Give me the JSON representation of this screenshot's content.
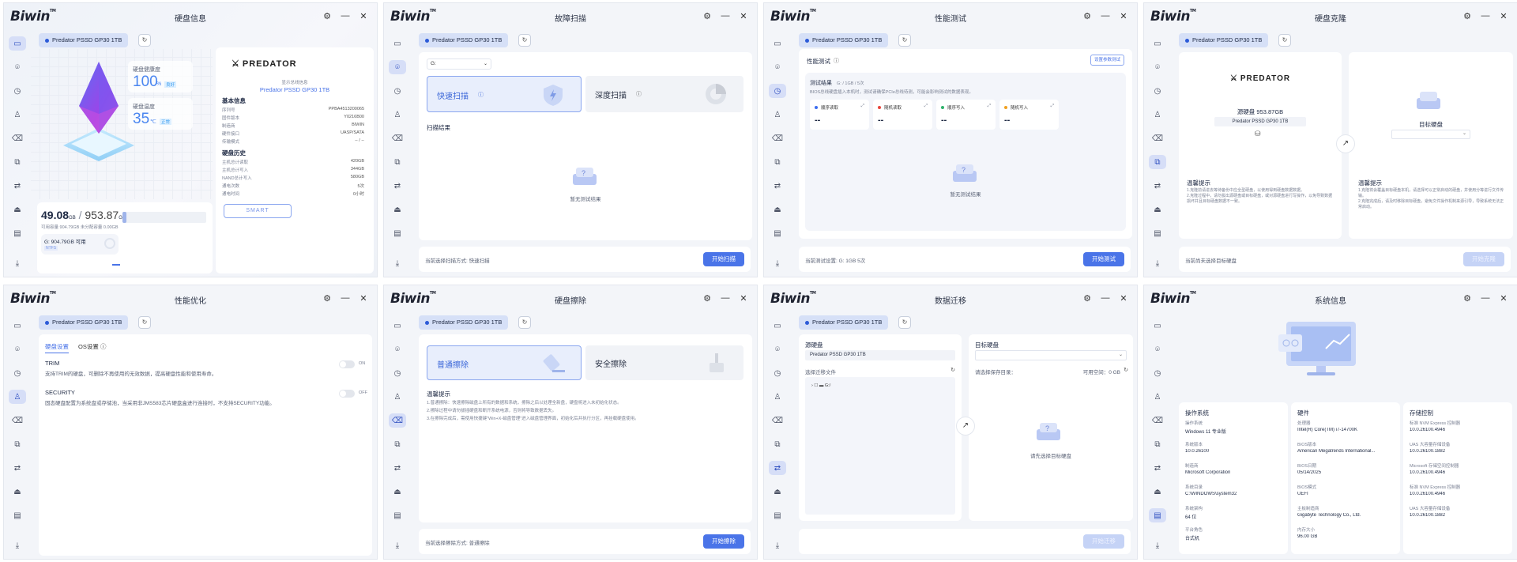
{
  "brand": {
    "logo_text": "Biwin"
  },
  "drive_name": "Predator PSSD GP30 1TB",
  "win1": {
    "title": "硬盘信息",
    "health_label": "硬盘健康度",
    "health_value": "100",
    "health_unit": "%",
    "health_badge": "良好",
    "temp_label": "硬盘温度",
    "temp_value": "35",
    "temp_unit": "℃",
    "temp_badge": "正常",
    "used": "49.08",
    "used_unit": "GB",
    "total": "953.87",
    "total_unit": "GB",
    "cap_sub": "可用容量 904.79GB  未分配容量 0.00GB",
    "usage_fraction": 0.05,
    "partition": "G: 904.79GB 可用",
    "partition_fs": "NTFS",
    "brand_logo": "PREDATOR",
    "model_small": "显示总线信息",
    "model": "Predator PSSD GP30 1TB",
    "basic_title": "基本信息",
    "basic": [
      {
        "k": "序列号",
        "v": "PPBA4513200065"
      },
      {
        "k": "固件版本",
        "v": "Y0216B00"
      },
      {
        "k": "制造商",
        "v": "BIWIN"
      },
      {
        "k": "硬件接口",
        "v": "UASP/SATA"
      },
      {
        "k": "传输模式",
        "v": "-- / --"
      }
    ],
    "history_title": "硬盘历史",
    "history": [
      {
        "k": "主机总计读取",
        "v": "420GB"
      },
      {
        "k": "主机总计写入",
        "v": "344GB"
      },
      {
        "k": "NAND总计写入",
        "v": "580GB"
      },
      {
        "k": "通电次数",
        "v": "5次"
      },
      {
        "k": "通电时间",
        "v": "0小时"
      }
    ],
    "smart_btn": "SMART"
  },
  "win2": {
    "title": "故障扫描",
    "drive_select": "G:",
    "quick_scan": "快速扫描",
    "deep_scan": "深度扫描",
    "result_title": "扫描结果",
    "empty_text": "暂无测试结果",
    "footer_text": "当前选择扫描方式: 快速扫描",
    "start_btn": "开始扫描"
  },
  "win3": {
    "title": "性能测试",
    "section": "性能测试",
    "settings_btn": "设置参数测试",
    "result_title": "测试结果",
    "result_meta": "G: / 1GB / 5次",
    "result_desc": "BIOS总线硬盘插入本机时，测试请确保PCIe总线待测，可能会影响测试的数据表现。",
    "cards": [
      {
        "label": "顺序读取",
        "value": "--",
        "color": "#3c6df0"
      },
      {
        "label": "随机读取",
        "value": "--",
        "color": "#e8453c"
      },
      {
        "label": "顺序写入",
        "value": "--",
        "color": "#2fb36b"
      },
      {
        "label": "随机写入",
        "value": "--",
        "color": "#f0a020"
      }
    ],
    "empty_text": "暂无测试结果",
    "footer_text": "当前测试设置: G:  1GB  5次",
    "start_btn": "开始测试"
  },
  "win4": {
    "title": "硬盘克隆",
    "brand_logo": "PREDATOR",
    "source_label": "源硬盘 953.87GB",
    "source_drive": "Predator PSSD GP30 1TB",
    "target_label": "目标硬盘",
    "tip_title_l": "温馨提示",
    "tip_l": "1.克隆前请进去等待备份中应全型硬盘，以使用得到硬盘数据数据。\n2.克隆过程中，请勿拔出源硬盘或目标硬盘，或对源硬盘进行写操作，以免导致数据损坏并且目标硬盘数据不一致。",
    "tip_title_r": "温馨提示",
    "tip_r": "1.克隆将会覆盖目标硬盘本机，请选择可以正常启动的硬盘，并使用分等进行文件传输。\n2.克隆完成后，请及时移除目标硬盘，避免文件操作机制来源引导，导致系统无法正常启动。",
    "footer_text": "当前尚未选择目标硬盘",
    "start_btn": "开始克隆"
  },
  "win5": {
    "title": "性能优化",
    "tab1": "硬盘设置",
    "tab2": "OS设置",
    "trim_title": "TRIM",
    "trim_desc": "支持TRIM的硬盘，可删除不再使用的无效数据，提高硬盘性能和使用寿命。",
    "trim_state": "ON",
    "security_title": "SECURITY",
    "security_desc": "固态硬盘配置为系统盘或存储池，当采用非JMS583芯片硬盘盒进行连接时，不支持SECURITY功能。",
    "security_state": "OFF"
  },
  "win6": {
    "title": "硬盘擦除",
    "normal_erase": "普通擦除",
    "secure_erase": "安全擦除",
    "tip_title": "温馨提示",
    "tips": [
      "1.普通擦除：快速擦除磁盘上所有的数据和系统，擦除之后以处理全新盘，硬盘将进入未初始化状态。",
      "2.擦除过程中请勿拔插硬盘和断开系统电源，否则将导致数据丢失。",
      "3.在擦除完成后，需使用快捷键\"Win+X-磁盘管理\"进入磁盘管理界面，初始化后并执行分区，再挂载硬盘使用。"
    ],
    "footer_text": "当前选择擦除方式: 普通擦除",
    "start_btn": "开始擦除"
  },
  "win7": {
    "title": "数据迁移",
    "source_label": "源硬盘",
    "source_drive": "Predator PSSD GP30 1TB",
    "select_files": "选择迁移文件",
    "tree_item": "G:/",
    "target_label": "目标硬盘",
    "target_path_label": "请选择保存目录：",
    "free_space": "可用空间：0 GB",
    "empty_text": "请先选择目标硬盘",
    "start_btn": "开始迁移"
  },
  "win8": {
    "title": "系统信息",
    "os_title": "操作系统",
    "os": [
      {
        "k": "操作系统",
        "v": "Windows 11 专业版"
      },
      {
        "k": "系统版本",
        "v": "10.0.26100"
      },
      {
        "k": "制造商",
        "v": "Microsoft Corporation"
      },
      {
        "k": "系统目录",
        "v": "C:\\WINDOWS\\system32"
      },
      {
        "k": "系统架构",
        "v": "64 位"
      },
      {
        "k": "平台角色",
        "v": "台式机"
      }
    ],
    "hw_title": "硬件",
    "hw": [
      {
        "k": "处理器",
        "v": "Intel(R) Core(TM) i7-14700K"
      },
      {
        "k": "BIOS版本",
        "v": "American Megatrends International..."
      },
      {
        "k": "BIOS日期",
        "v": "05/14/2025"
      },
      {
        "k": "BIOS模式",
        "v": "UEFI"
      },
      {
        "k": "主板制造商",
        "v": "Gigabyte Technology Co., Ltd."
      },
      {
        "k": "内存大小",
        "v": "96.00 GB"
      }
    ],
    "ctrl_title": "存储控制",
    "ctrl": [
      {
        "k": "标准 NVM Express 控制器",
        "v": "10.0.26100.4946"
      },
      {
        "k": "UAS 大容量存储设备",
        "v": "10.0.26100.1882"
      },
      {
        "k": "Microsoft 存储空间控制器",
        "v": "10.0.26100.4946"
      },
      {
        "k": "标准 NVM Express 控制器",
        "v": "10.0.26100.4946"
      },
      {
        "k": "UAS 大容量存储设备",
        "v": "10.0.26100.1882"
      }
    ]
  }
}
